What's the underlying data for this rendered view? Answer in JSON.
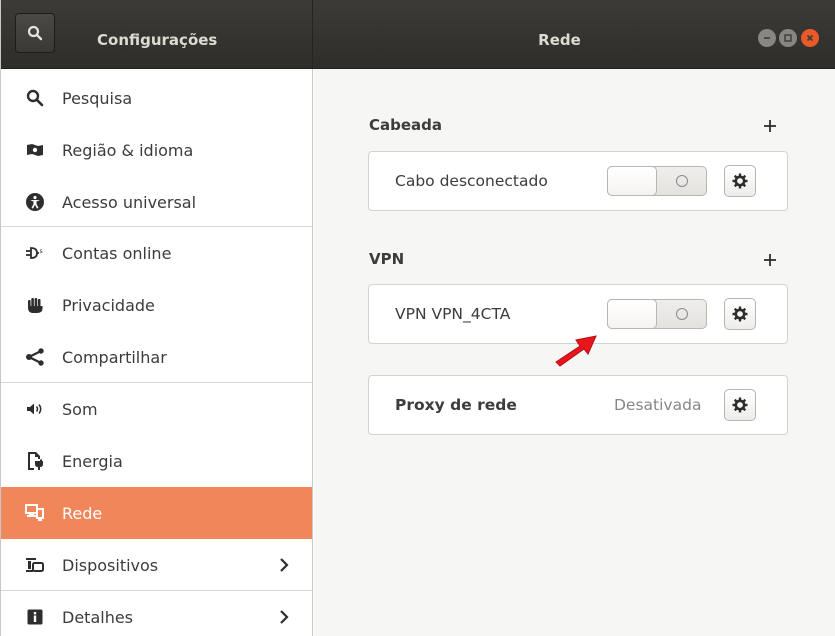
{
  "header": {
    "app_title": "Configurações",
    "page_title": "Rede"
  },
  "sidebar": {
    "items": [
      {
        "label": "Pesquisa",
        "icon": "search-icon"
      },
      {
        "label": "Região & idioma",
        "icon": "region-flag-icon"
      },
      {
        "label": "Acesso universal",
        "icon": "accessibility-icon"
      },
      {
        "label": "Contas online",
        "icon": "online-accounts-icon"
      },
      {
        "label": "Privacidade",
        "icon": "hand-icon"
      },
      {
        "label": "Compartilhar",
        "icon": "share-icon"
      },
      {
        "label": "Som",
        "icon": "speaker-icon"
      },
      {
        "label": "Energia",
        "icon": "power-icon"
      },
      {
        "label": "Rede",
        "icon": "network-icon",
        "selected": true
      },
      {
        "label": "Dispositivos",
        "icon": "devices-icon",
        "has_submenu": true
      },
      {
        "label": "Detalhes",
        "icon": "info-icon",
        "has_submenu": true
      }
    ]
  },
  "main": {
    "wired": {
      "title": "Cabeada",
      "connection_label": "Cabo desconectado",
      "enabled": false
    },
    "vpn": {
      "title": "VPN",
      "connection_label": "VPN VPN_4CTA",
      "enabled": false
    },
    "proxy": {
      "label": "Proxy de rede",
      "status": "Desativada"
    }
  },
  "colors": {
    "accent": "#f0865a",
    "headerbar": "#3c3b37",
    "close_button": "#e95a2a",
    "annotation_arrow": "#e8151b"
  }
}
